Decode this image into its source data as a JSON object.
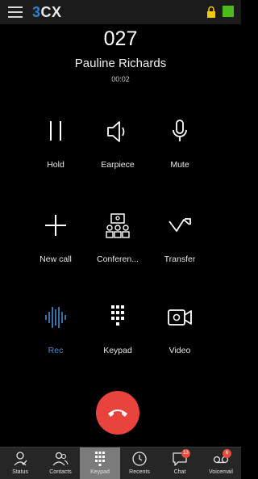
{
  "header": {
    "logo_num": "3",
    "logo_text": "CX"
  },
  "call": {
    "number": "027",
    "name": "Pauline Richards",
    "timer": "00:02"
  },
  "actions": [
    {
      "label": "Hold",
      "icon": "pause-icon"
    },
    {
      "label": "Earpiece",
      "icon": "speaker-icon"
    },
    {
      "label": "Mute",
      "icon": "microphone-icon"
    },
    {
      "label": "New call",
      "icon": "plus-icon"
    },
    {
      "label": "Conferen...",
      "icon": "conference-icon"
    },
    {
      "label": "Transfer",
      "icon": "transfer-icon"
    },
    {
      "label": "Rec",
      "icon": "waveform-icon"
    },
    {
      "label": "Keypad",
      "icon": "keypad-icon"
    },
    {
      "label": "Video",
      "icon": "video-icon"
    }
  ],
  "tabs": [
    {
      "label": "Status",
      "icon": "status-icon"
    },
    {
      "label": "Contacts",
      "icon": "contacts-icon"
    },
    {
      "label": "Keypad",
      "icon": "keypad-icon",
      "active": true
    },
    {
      "label": "Recents",
      "icon": "clock-icon"
    },
    {
      "label": "Chat",
      "icon": "chat-icon",
      "badge": "13"
    },
    {
      "label": "Voicemail",
      "icon": "voicemail-icon",
      "badge": "6"
    }
  ],
  "colors": {
    "accent": "#2f7fd0",
    "hangup": "#e8433c",
    "status_green": "#4cbb17",
    "lock_yellow": "#f2c811",
    "badge": "#e84c3d"
  }
}
